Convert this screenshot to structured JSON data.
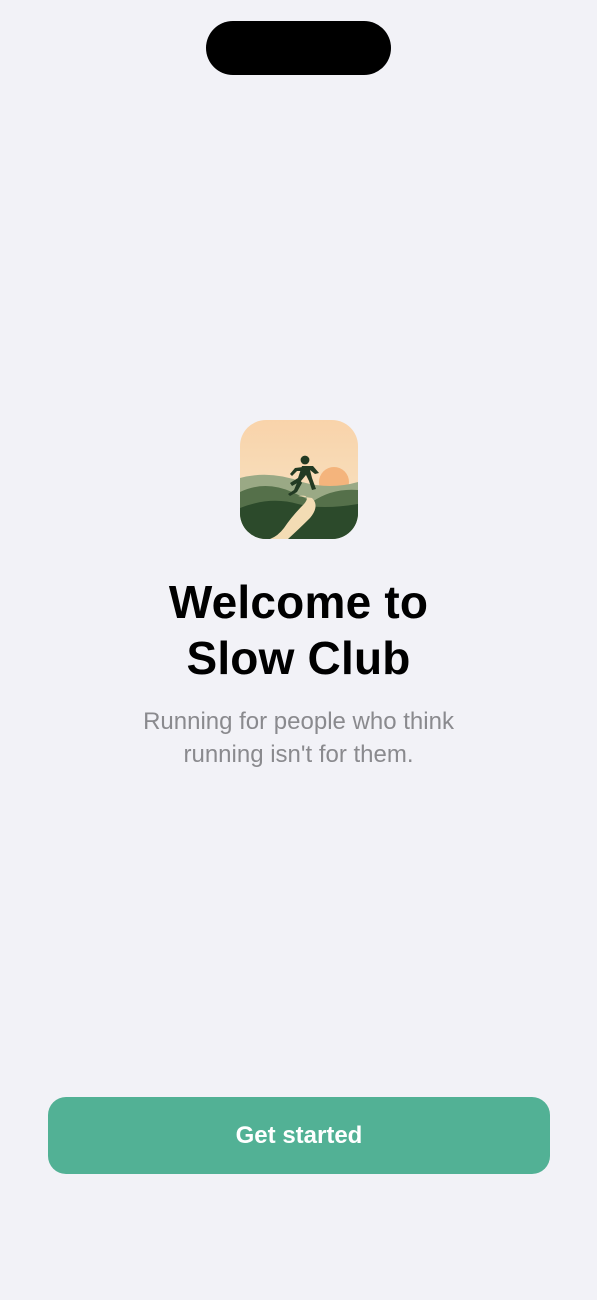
{
  "colors": {
    "background": "#f2f2f7",
    "accent": "#52b195",
    "title": "#000000",
    "subtitle": "#8a8a8e"
  },
  "app_icon": {
    "icon": "runner-sunset-landscape-icon"
  },
  "welcome": {
    "title_line1": "Welcome to",
    "title_line2": "Slow Club",
    "subtitle_line1": "Running for people who think",
    "subtitle_line2": "running isn't for them."
  },
  "actions": {
    "get_started_label": "Get started"
  }
}
